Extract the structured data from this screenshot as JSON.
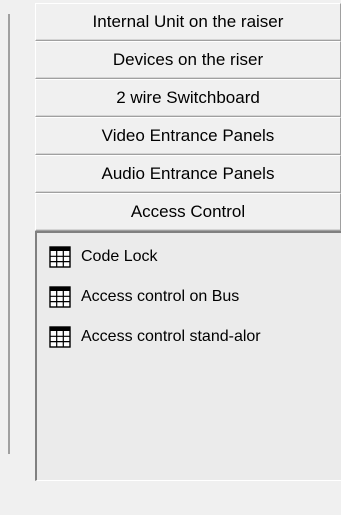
{
  "sections": [
    {
      "label": "Internal Unit on the raiser"
    },
    {
      "label": "Devices on the riser"
    },
    {
      "label": "2 wire Switchboard"
    },
    {
      "label": "Video Entrance Panels"
    },
    {
      "label": "Audio Entrance Panels"
    },
    {
      "label": "Access Control"
    }
  ],
  "active_section": "Access Control",
  "items": [
    {
      "label": "Code Lock",
      "icon": "grid-icon"
    },
    {
      "label": "Access control on Bus",
      "icon": "grid-icon"
    },
    {
      "label": "Access control stand-alor",
      "icon": "grid-icon"
    }
  ]
}
